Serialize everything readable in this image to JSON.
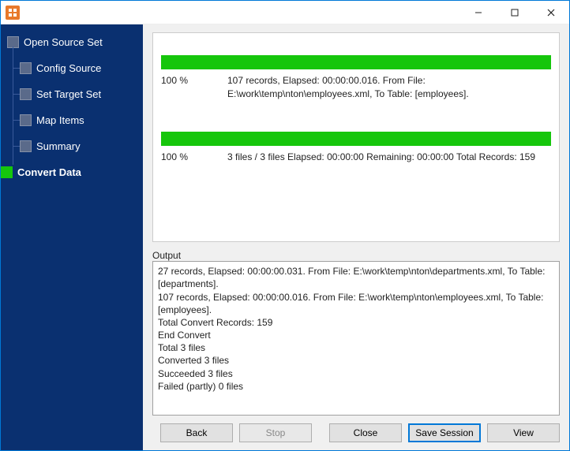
{
  "sidebar": {
    "items": [
      {
        "label": "Open Source Set",
        "indent": 0,
        "active": false
      },
      {
        "label": "Config Source",
        "indent": 1,
        "active": false
      },
      {
        "label": "Set Target Set",
        "indent": 1,
        "active": false
      },
      {
        "label": "Map Items",
        "indent": 1,
        "active": false
      },
      {
        "label": "Summary",
        "indent": 1,
        "active": false
      },
      {
        "label": "Convert Data",
        "indent": 0,
        "active": true
      }
    ]
  },
  "progress1": {
    "percent": "100 %",
    "line1": "107 records,    Elapsed: 00:00:00.016.    From File:",
    "line2": "E:\\work\\temp\\nton\\employees.xml,    To Table: [employees]."
  },
  "progress2": {
    "percent": "100 %",
    "info": "3 files / 3 files    Elapsed: 00:00:00    Remaining: 00:00:00    Total Records: 159"
  },
  "output_label": "Output",
  "output_lines": [
    "27 records,    Elapsed: 00:00:00.031.    From File: E:\\work\\temp\\nton\\departments.xml,    To Table: [departments].",
    "107 records,    Elapsed: 00:00:00.016.    From File: E:\\work\\temp\\nton\\employees.xml,    To Table: [employees].",
    "Total Convert Records: 159",
    "End Convert",
    "Total 3 files",
    "Converted 3 files",
    "Succeeded 3 files",
    "Failed (partly) 0 files"
  ],
  "buttons": {
    "back": "Back",
    "stop": "Stop",
    "close": "Close",
    "save_session": "Save Session",
    "view": "View"
  }
}
